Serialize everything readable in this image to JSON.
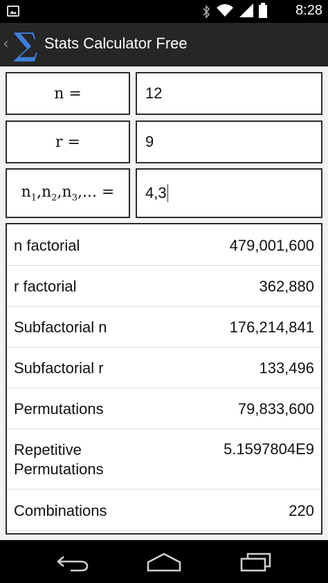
{
  "status_bar": {
    "time": "8:28",
    "icons": [
      "image-icon",
      "bluetooth-icon",
      "wifi-icon",
      "signal-icon",
      "battery-icon"
    ]
  },
  "action_bar": {
    "title": "Stats Calculator Free",
    "logo_glyph": "∑",
    "back_glyph": "‹"
  },
  "inputs": {
    "n": {
      "label": "n =",
      "value": "12"
    },
    "r": {
      "label": "r =",
      "value": "9"
    },
    "list": {
      "label": "n1,n2,n3,... =",
      "value": "4,3"
    }
  },
  "results": [
    {
      "label": "n factorial",
      "value": "479,001,600"
    },
    {
      "label": "r factorial",
      "value": "362,880"
    },
    {
      "label": "Subfactorial n",
      "value": "176,214,841"
    },
    {
      "label": "Subfactorial r",
      "value": "133,496"
    },
    {
      "label": "Permutations",
      "value": "79,833,600"
    },
    {
      "label_line1": "Repetitive",
      "label_line2": "Permutations",
      "value": "5.1597804E9"
    },
    {
      "label": "Combinations",
      "value": "220"
    }
  ],
  "colors": {
    "accent": "#3f7dd8",
    "action_bar": "#262626",
    "background": "#f3f3f3"
  }
}
